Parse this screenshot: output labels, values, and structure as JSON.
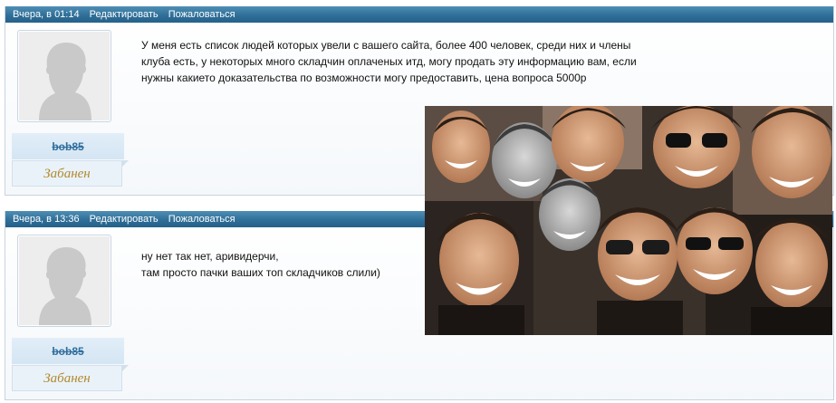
{
  "posts": [
    {
      "date": "Вчера, в 01:14",
      "edit_label": "Редактировать",
      "report_label": "Пожаловаться",
      "username": "bob85",
      "status": "Забанен",
      "message_lines": [
        "У меня есть список людей которых увели с вашего сайта, более 400 человек, среди них и члены клуба есть, у некоторых много складчин оплаченых итд, могу продать эту информацию вам, если нужны какието доказательства по возможности могу предоставить, цена вопроса 5000р"
      ]
    },
    {
      "date": "Вчера, в 13:36",
      "edit_label": "Редактировать",
      "report_label": "Пожаловаться",
      "username": "bob85",
      "status": "Забанен",
      "message_lines": [
        "ну нет так нет, аривидерчи,",
        "там просто пачки ваших топ складчиков слили)"
      ]
    }
  ],
  "colors": {
    "header": "#2f6f98",
    "username": "#2f6e9d",
    "status": "#b08a2e"
  }
}
